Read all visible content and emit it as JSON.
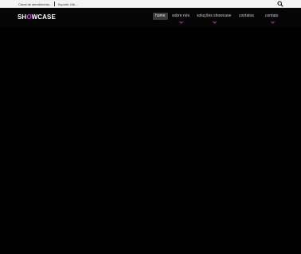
{
  "topbar": {
    "link1": "Canal de atendimento...",
    "link2": "Suporte 24h...",
    "search_icon": "search-icon"
  },
  "logo": {
    "part1": "SH",
    "accent": "O",
    "part2": "WCASE",
    "accent_color": "#d63fd6"
  },
  "nav": {
    "home": "home",
    "sobre": "sobre nós",
    "solucoes": "soluções showcase",
    "contatos": "contatos",
    "contato": "contato"
  }
}
